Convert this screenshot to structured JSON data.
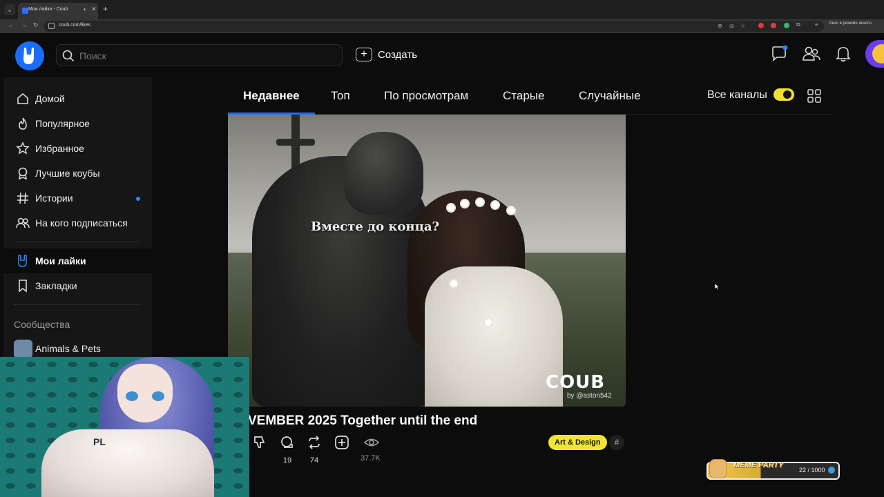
{
  "browser": {
    "tab_title": "Мои лайки - Coub",
    "url": "coub.com/likes",
    "incognito_label": "Окно в режиме инкогн"
  },
  "header": {
    "search_placeholder": "Поиск",
    "create_label": "Создать"
  },
  "sidebar": {
    "items": [
      {
        "label": "Домой",
        "icon": "home-icon"
      },
      {
        "label": "Популярное",
        "icon": "flame-icon"
      },
      {
        "label": "Избранное",
        "icon": "star-icon"
      },
      {
        "label": "Лучшие коубы",
        "icon": "award-icon"
      },
      {
        "label": "Истории",
        "icon": "hash-icon"
      },
      {
        "label": "На кого подписаться",
        "icon": "people-icon"
      },
      {
        "label": "Мои лайки",
        "icon": "rock-hand-icon"
      },
      {
        "label": "Закладки",
        "icon": "bookmark-icon"
      }
    ],
    "section_title": "Сообщества",
    "communities": [
      {
        "label": "Animals & Pets"
      }
    ],
    "accent_color": "#2b87ff"
  },
  "tabs": {
    "items": [
      "Недавнее",
      "Топ",
      "По просмотрам",
      "Старые",
      "Случайные"
    ],
    "active_index": 0,
    "channels_label": "Все каналы",
    "channels_toggle_on": true
  },
  "coub": {
    "caption": "Вместе до конца?",
    "watermark": "COUB",
    "watermark_by": "by @aston542",
    "title": "VEMBER 2025 Together until the end",
    "stats": {
      "recoubs": "19",
      "reposts": "74",
      "views": "37.7K"
    },
    "tag": "Art & Design",
    "hash_label": "#"
  },
  "webcam": {
    "overlay_text": "PL"
  },
  "meme_widget": {
    "title": "MEME PARTY",
    "count": "22 / 1000"
  },
  "colors": {
    "brand_blue": "#1a6dff",
    "tag_yellow": "#f2e531"
  }
}
